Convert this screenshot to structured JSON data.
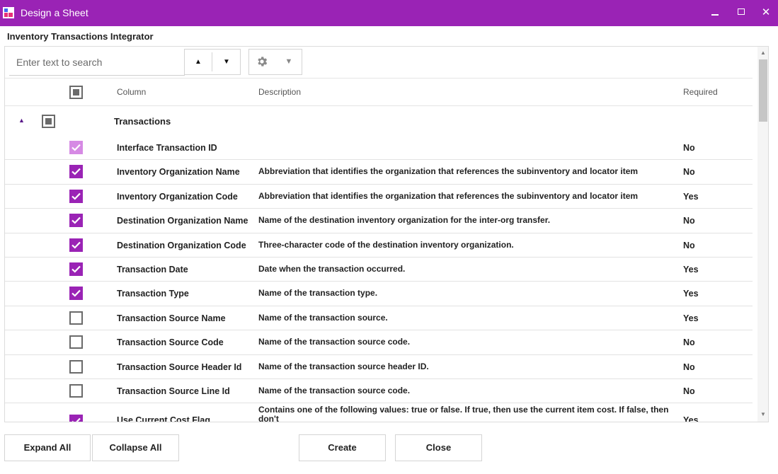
{
  "window": {
    "title": "Design a Sheet",
    "minimize_icon": "minimize-icon",
    "maximize_icon": "maximize-icon",
    "close_glyph": "✕",
    "accent": "#9a23b5"
  },
  "subtitle": "Inventory Transactions Integrator",
  "toolbar": {
    "search_placeholder": "Enter text to search",
    "search_value": "",
    "up_glyph": "▲",
    "down_glyph": "▼",
    "gear_icon": "gear-icon",
    "gear_caret_glyph": "▼"
  },
  "grid": {
    "headers": {
      "column": "Column",
      "description": "Description",
      "required": "Required"
    },
    "group": {
      "label": "Transactions",
      "expanded": true,
      "caret_glyph": "▲"
    },
    "rows": [
      {
        "column": "Interface Transaction ID",
        "description": "",
        "required": "No",
        "checked": true,
        "disabled": true
      },
      {
        "column": "Inventory Organization Name",
        "description": "Abbreviation that identifies the organization that references the subinventory and locator item",
        "required": "No",
        "checked": true
      },
      {
        "column": "Inventory Organization Code",
        "description": "Abbreviation that identifies the organization that references the subinventory and locator item",
        "required": "Yes",
        "checked": true
      },
      {
        "column": "Destination Organization Name",
        "description": "Name of the destination inventory organization for the inter-org transfer.",
        "required": "No",
        "checked": true
      },
      {
        "column": "Destination Organization Code",
        "description": "Three-character code of the destination inventory organization.",
        "required": "No",
        "checked": true
      },
      {
        "column": "Transaction Date",
        "description": "Date when the transaction occurred.",
        "required": "Yes",
        "checked": true
      },
      {
        "column": "Transaction Type",
        "description": "Name of the transaction type.",
        "required": "Yes",
        "checked": true
      },
      {
        "column": "Transaction Source Name",
        "description": "Name of the transaction source.",
        "required": "Yes",
        "checked": false
      },
      {
        "column": "Transaction Source Code",
        "description": "Name of the transaction source code.",
        "required": "No",
        "checked": false
      },
      {
        "column": "Transaction Source Header Id",
        "description": "Name of the transaction source header ID.",
        "required": "No",
        "checked": false
      },
      {
        "column": "Transaction Source Line Id",
        "description": "Name of the transaction source code.",
        "required": "No",
        "checked": false
      },
      {
        "column": "Use Current Cost Flag",
        "description": "Contains one of the following values: true or false. If true, then use the current item cost. If false, then don't",
        "required": "Yes",
        "checked": true
      }
    ]
  },
  "scrollbar": {
    "up_glyph": "▲",
    "down_glyph": "▼"
  },
  "buttons": {
    "expand_all": "Expand All",
    "collapse_all": "Collapse All",
    "create": "Create",
    "close": "Close"
  }
}
